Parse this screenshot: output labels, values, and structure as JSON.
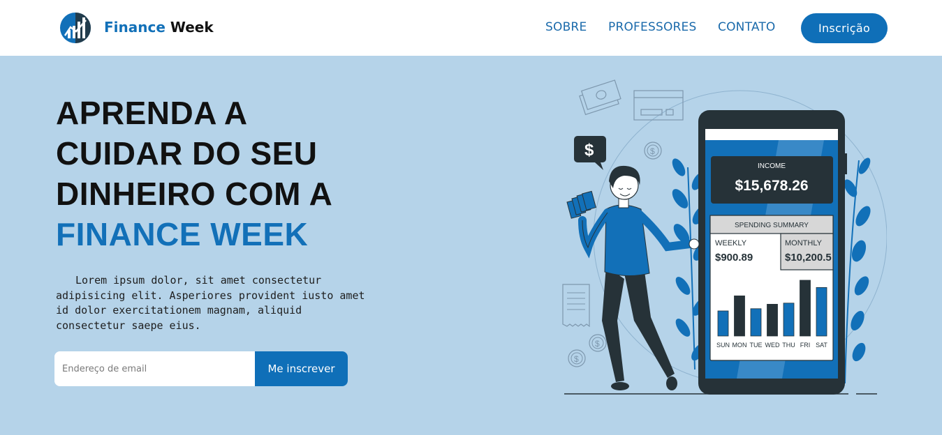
{
  "header": {
    "brand_first": "Finance",
    "brand_second": "Week",
    "nav": [
      "SOBRE",
      "PROFESSORES",
      "CONTATO"
    ],
    "cta_label": "Inscrição"
  },
  "hero": {
    "title_lines": [
      "APRENDA A",
      "CUIDAR DO SEU",
      "DINHEIRO COM A"
    ],
    "title_highlight": "FINANCE WEEK",
    "paragraph": "Lorem ipsum dolor, sit amet consectetur adipisicing elit. Asperiores provident iusto amet id dolor exercitationem magnam, aliquid consectetur saepe eius.",
    "email_placeholder": "Endereço de email",
    "submit_label": "Me inscrever"
  },
  "illustration": {
    "speech_symbol": "$",
    "income_label": "INCOME",
    "income_value": "$15,678.26",
    "spending_title": "SPENDING SUMMARY",
    "weekly_label": "WEEKLY",
    "weekly_value": "$900.89",
    "monthly_label": "MONTHLY",
    "monthly_value": "$10,200.5",
    "days": [
      "SUN",
      "MON",
      "TUE",
      "WED",
      "THU",
      "FRI",
      "SAT"
    ],
    "bar_levels": [
      0.45,
      0.72,
      0.49,
      0.57,
      0.59,
      1.0,
      0.87
    ],
    "bar_colors": [
      "#1270b8",
      "#263238",
      "#1270b8",
      "#263238",
      "#1270b8",
      "#263238",
      "#1270b8"
    ]
  },
  "colors": {
    "accent": "#1270b8",
    "hero_background": "#b5d3e9",
    "dark": "#263238"
  },
  "icons": [
    "logo-icon",
    "dollar-speech-bubble-icon",
    "cash-notes-icon",
    "credit-card-icon",
    "coin-icon",
    "receipt-icon",
    "leaf-plant-icon"
  ]
}
